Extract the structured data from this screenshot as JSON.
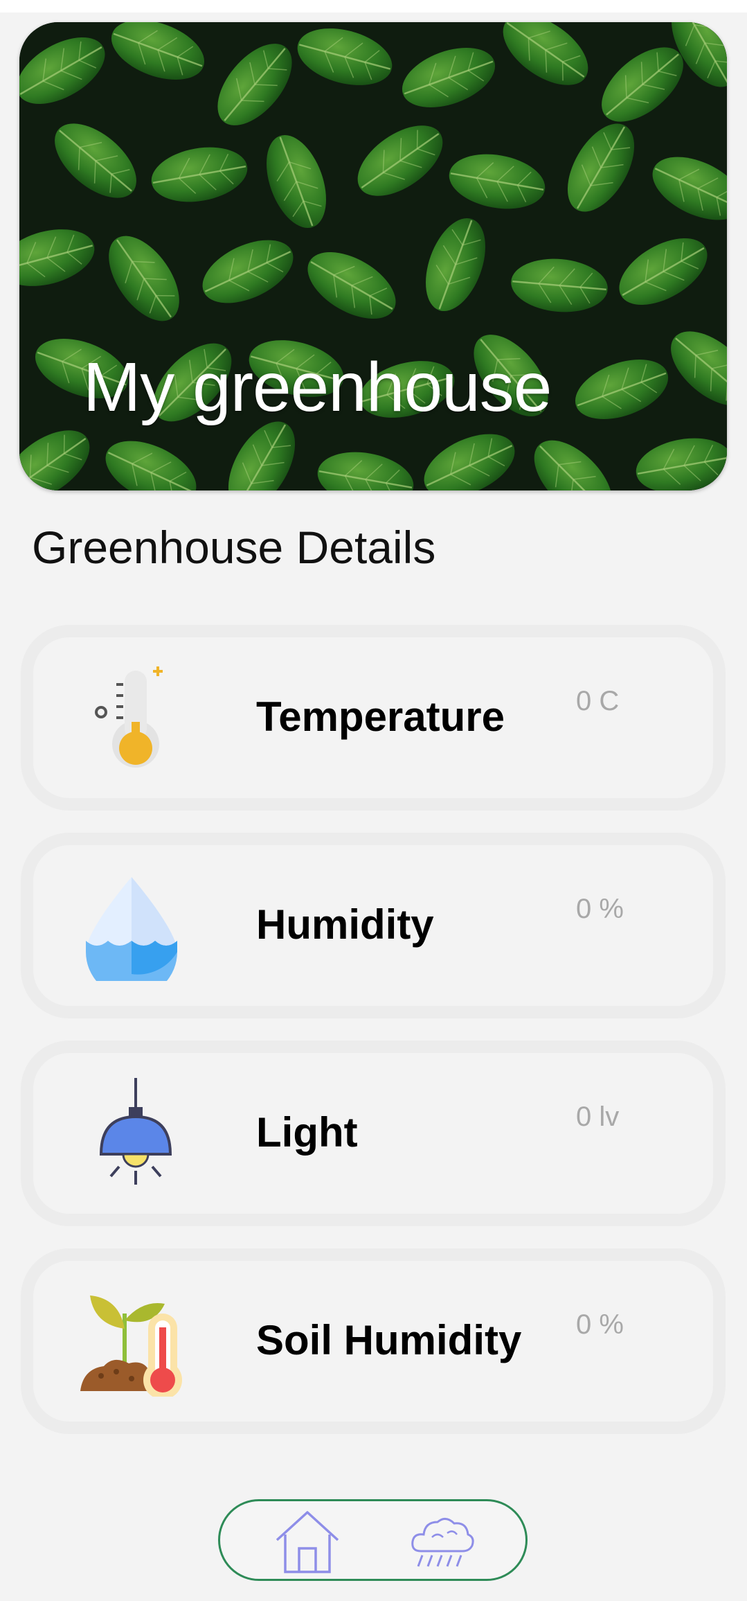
{
  "header": {
    "title": "My greenhouse"
  },
  "section": {
    "title": "Greenhouse Details"
  },
  "metrics": [
    {
      "label": "Temperature",
      "value": "0 C",
      "icon": "thermometer-icon"
    },
    {
      "label": "Humidity",
      "value": "0 %",
      "icon": "water-drop-icon"
    },
    {
      "label": "Light",
      "value": "0 lv",
      "icon": "lamp-icon"
    },
    {
      "label": "Soil Humidity",
      "value": "0 %",
      "icon": "plant-soil-thermometer-icon"
    }
  ],
  "nav": [
    {
      "name": "home",
      "icon": "home-icon"
    },
    {
      "name": "weather",
      "icon": "rain-cloud-icon"
    }
  ],
  "colors": {
    "background": "#f3f3f3",
    "card_border": "#ececec",
    "nav_border": "#2e8b57",
    "nav_icon": "#8e8ee8",
    "value_text": "#a8a8a8"
  }
}
